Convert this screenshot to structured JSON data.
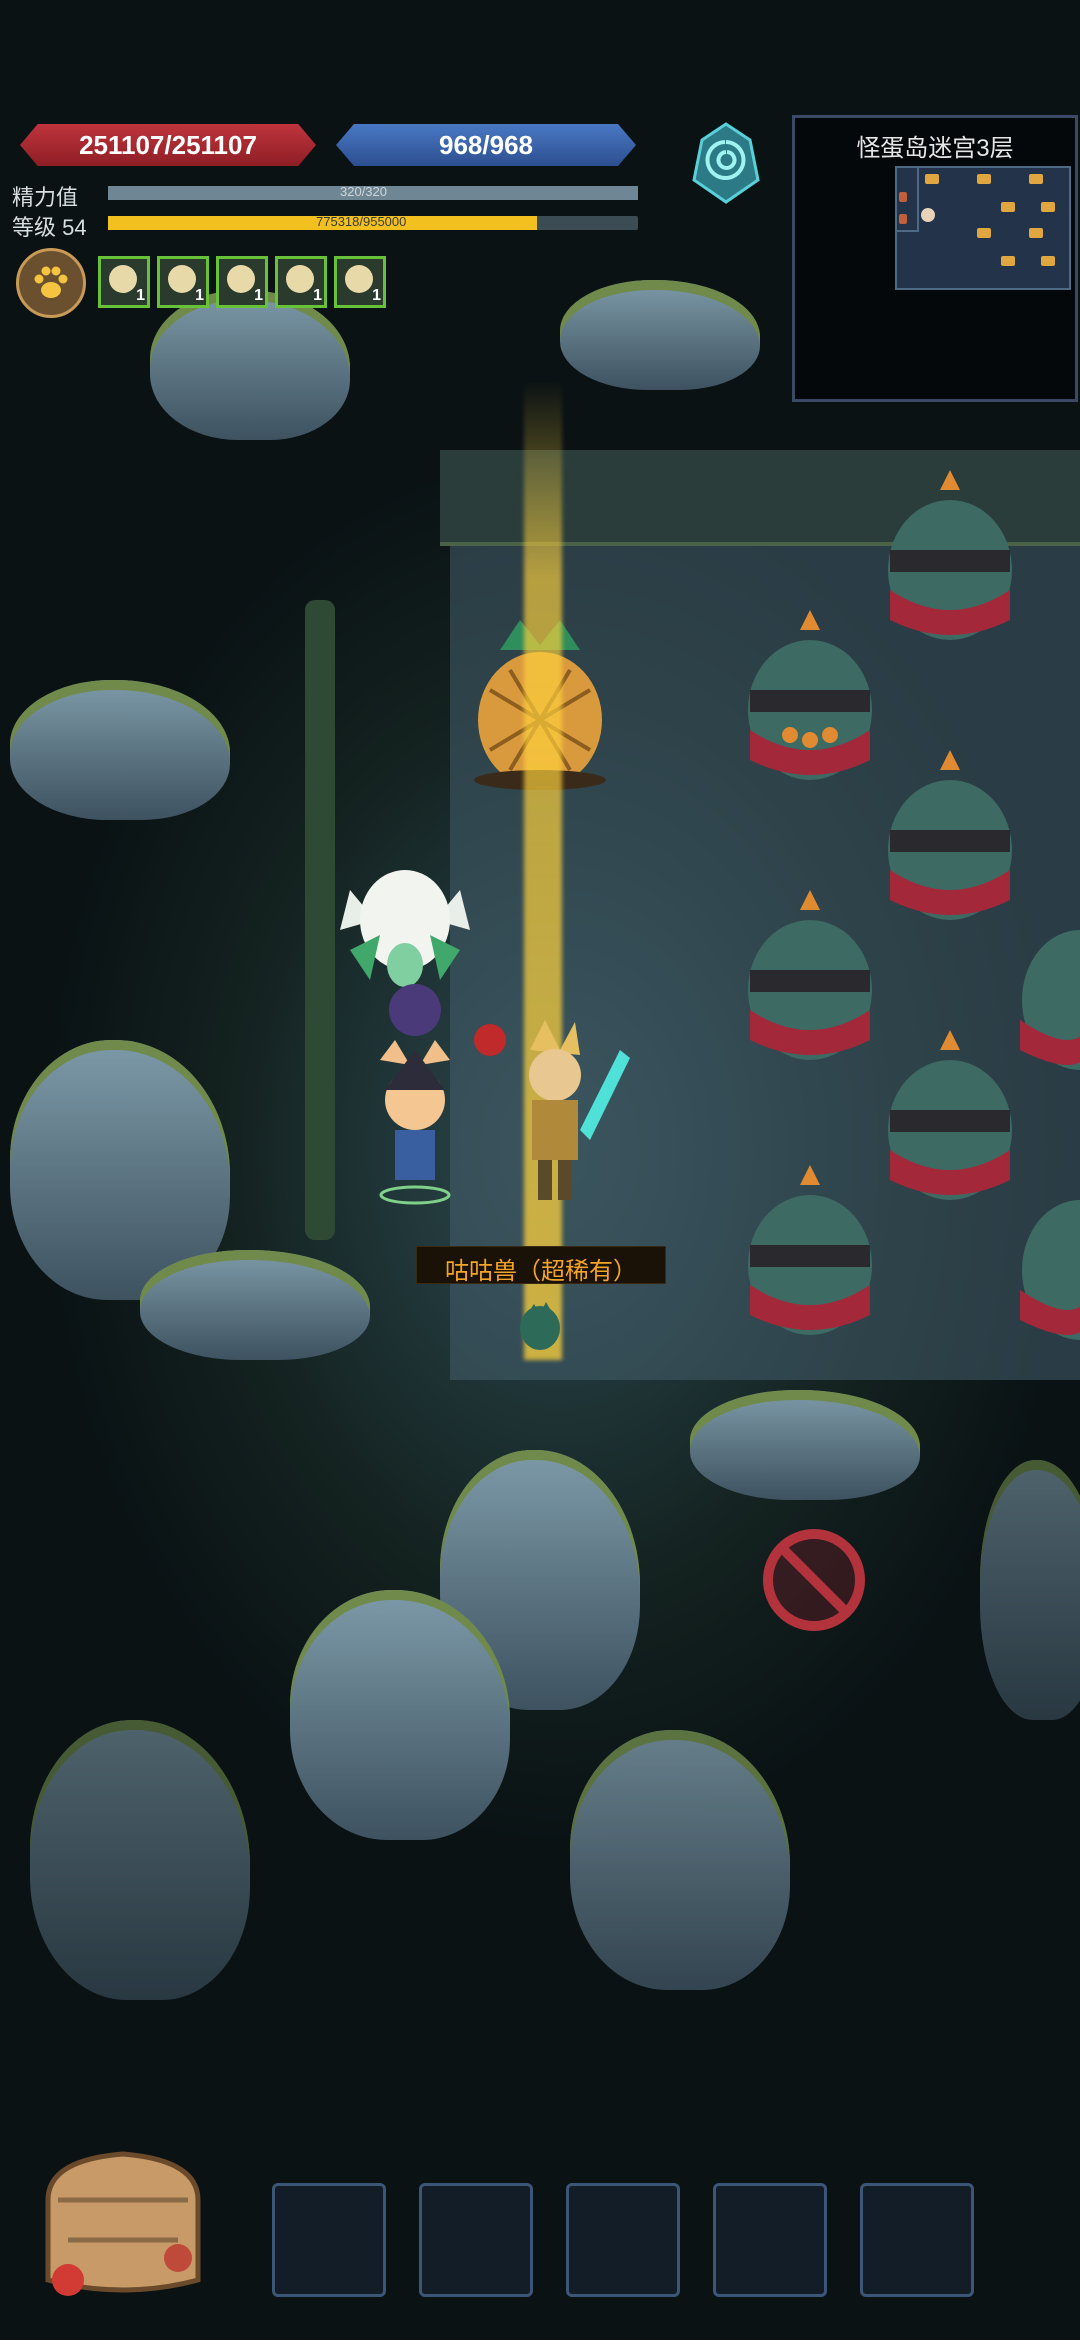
{
  "hud": {
    "hp_text": "251107/251107",
    "mp_text": "968/968",
    "stamina_label": "精力值",
    "stamina_text": "320/320",
    "stamina_ratio": 1.0,
    "level_label": "等级 54",
    "exp_text": "775318/955000",
    "exp_ratio": 0.81,
    "pet_icon": "paw-icon",
    "buffs": [
      {
        "count": "1"
      },
      {
        "count": "1"
      },
      {
        "count": "1"
      },
      {
        "count": "1"
      },
      {
        "count": "1"
      }
    ],
    "portal_icon": "portal-icon"
  },
  "minimap": {
    "title": "怪蛋岛迷宫3层"
  },
  "scene": {
    "pickup_label": "咕咕兽（超稀有）",
    "blocked_icon": "no-entry-icon"
  },
  "bottom": {
    "bag_icon": "backpack-icon",
    "slots": [
      "",
      "",
      "",
      "",
      ""
    ]
  },
  "colors": {
    "hp": "#c0343c",
    "mp": "#3f67b0",
    "exp": "#f2c11f",
    "buff_border": "#67c23a",
    "pickup_text": "#f4a42a"
  }
}
